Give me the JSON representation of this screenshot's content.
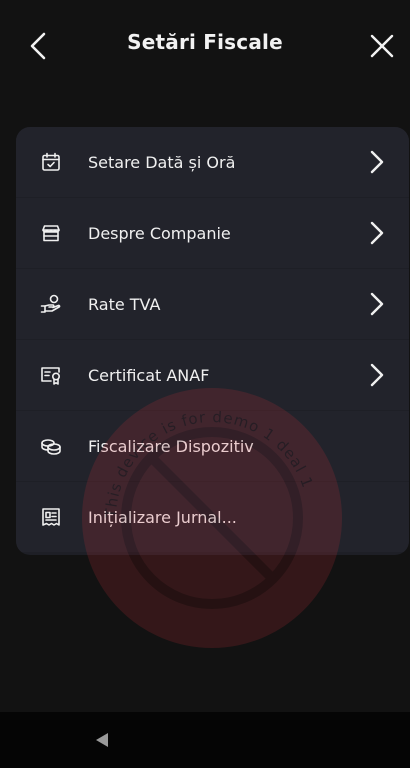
{
  "header": {
    "title": "Setări Fiscale",
    "back_icon": "chevron-left-icon",
    "close_icon": "close-icon"
  },
  "menu": {
    "items": [
      {
        "label": "Setare Dată și Oră",
        "icon": "calendar-check-icon",
        "has_chevron": true
      },
      {
        "label": "Despre Companie",
        "icon": "store-icon",
        "has_chevron": true
      },
      {
        "label": "Rate TVA",
        "icon": "hand-coins-icon",
        "has_chevron": true
      },
      {
        "label": "Certificat ANAF",
        "icon": "certificate-icon",
        "has_chevron": true
      },
      {
        "label": "Fiscalizare Dispozitiv",
        "icon": "coins-stack-icon",
        "has_chevron": false
      },
      {
        "label": "Inițializare Jurnal...",
        "icon": "receipt-icon",
        "has_chevron": false
      }
    ]
  },
  "watermark": {
    "text": "This device is for demo 1 deal 1"
  },
  "navbar": {
    "back_icon": "triangle-back-icon"
  },
  "colors": {
    "background": "#121212",
    "card": "#22232b",
    "text": "#f0f0f0",
    "watermark": "#d0303a"
  }
}
